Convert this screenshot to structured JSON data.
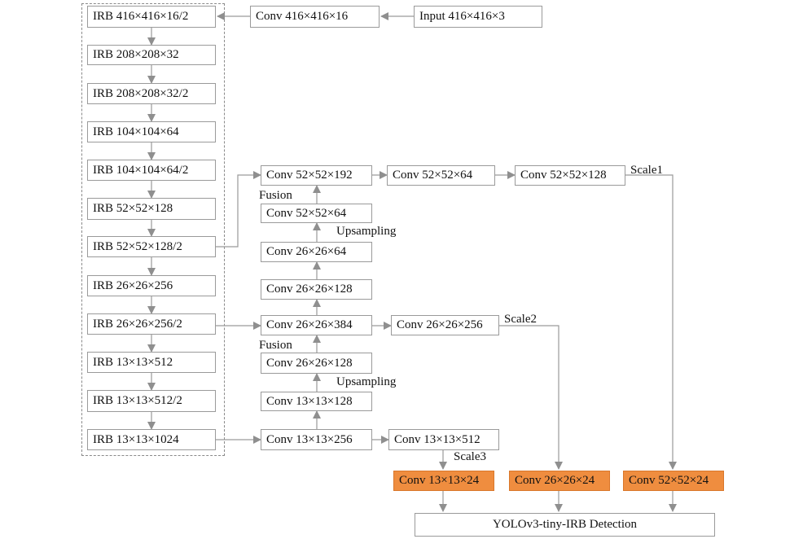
{
  "backbone": {
    "irb": [
      "IRB 416×416×16/2",
      "IRB 208×208×32",
      "IRB 208×208×32/2",
      "IRB 104×104×64",
      "IRB 104×104×64/2",
      "IRB 52×52×128",
      "IRB 52×52×128/2",
      "IRB 26×26×256",
      "IRB 26×26×256/2",
      "IRB 13×13×512",
      "IRB 13×13×512/2",
      "IRB 13×13×1024"
    ]
  },
  "top": {
    "input": "Input 416×416×3",
    "conv": "Conv 416×416×16"
  },
  "neck": {
    "c52_192": "Conv 52×52×192",
    "c52_64a": "Conv 52×52×64",
    "c52_64b": "Conv 52×52×64",
    "c52_128": "Conv 52×52×128",
    "c26_64": "Conv 26×26×64",
    "c26_128a": "Conv 26×26×128",
    "c26_384": "Conv 26×26×384",
    "c26_256": "Conv 26×26×256",
    "c26_128b": "Conv 26×26×128",
    "c13_128": "Conv 13×13×128",
    "c13_256": "Conv 13×13×256",
    "c13_512": "Conv 13×13×512"
  },
  "heads": {
    "h13": "Conv 13×13×24",
    "h26": "Conv 26×26×24",
    "h52": "Conv 52×52×24"
  },
  "detection": "YOLOv3-tiny-IRB Detection",
  "labels": {
    "fusion1": "Fusion",
    "upsampling1": "Upsampling",
    "fusion2": "Fusion",
    "upsampling2": "Upsampling",
    "scale1": "Scale1",
    "scale2": "Scale2",
    "scale3": "Scale3"
  },
  "colors": {
    "line": "#9a9a9a",
    "head_fill": "#ef8d3f"
  }
}
